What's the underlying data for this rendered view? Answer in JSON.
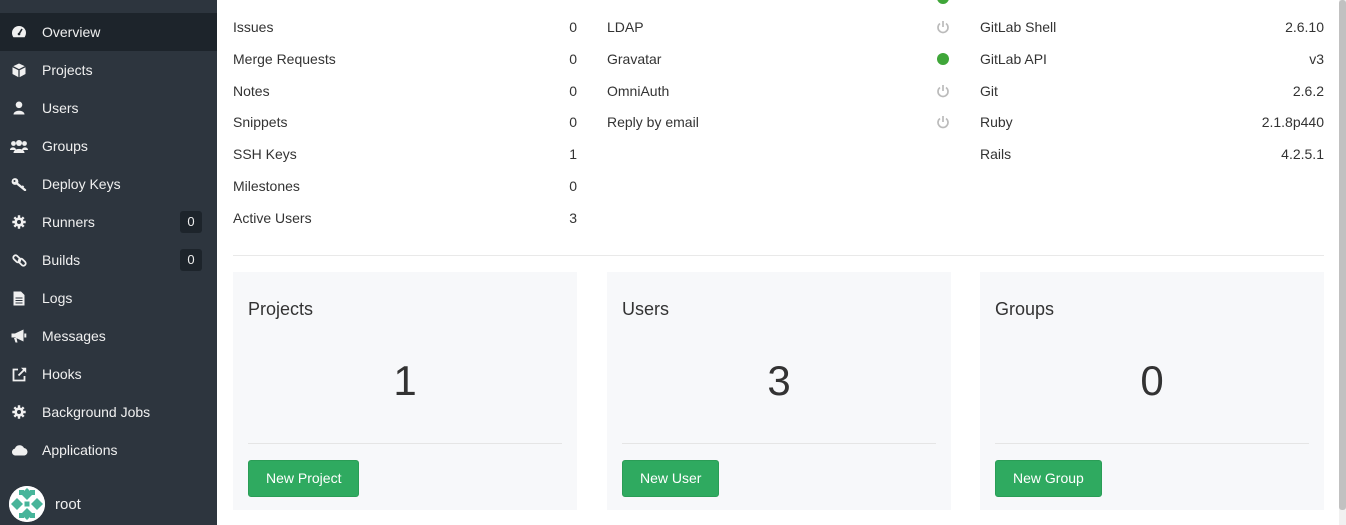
{
  "sidebar": {
    "items": [
      {
        "label": "Overview",
        "icon": "dashboard-icon",
        "active": true
      },
      {
        "label": "Projects",
        "icon": "cube-icon"
      },
      {
        "label": "Users",
        "icon": "user-icon"
      },
      {
        "label": "Groups",
        "icon": "users-icon"
      },
      {
        "label": "Deploy Keys",
        "icon": "key-icon"
      },
      {
        "label": "Runners",
        "icon": "cog-icon",
        "count": "0"
      },
      {
        "label": "Builds",
        "icon": "link-icon",
        "count": "0"
      },
      {
        "label": "Logs",
        "icon": "file-text-icon"
      },
      {
        "label": "Messages",
        "icon": "bullhorn-icon"
      },
      {
        "label": "Hooks",
        "icon": "external-link-icon"
      },
      {
        "label": "Background Jobs",
        "icon": "cog-icon"
      },
      {
        "label": "Applications",
        "icon": "cloud-icon"
      }
    ],
    "user": {
      "name": "root"
    }
  },
  "stats": [
    {
      "label": "Issues",
      "value": "0"
    },
    {
      "label": "Merge Requests",
      "value": "0"
    },
    {
      "label": "Notes",
      "value": "0"
    },
    {
      "label": "Snippets",
      "value": "0"
    },
    {
      "label": "SSH Keys",
      "value": "1"
    },
    {
      "label": "Milestones",
      "value": "0"
    },
    {
      "label": "Active Users",
      "value": "3"
    }
  ],
  "features": [
    {
      "label": "LDAP",
      "status": "off"
    },
    {
      "label": "Gravatar",
      "status": "on"
    },
    {
      "label": "OmniAuth",
      "status": "off"
    },
    {
      "label": "Reply by email",
      "status": "off"
    }
  ],
  "components": [
    {
      "label": "GitLab Shell",
      "value": "2.6.10"
    },
    {
      "label": "GitLab API",
      "value": "v3"
    },
    {
      "label": "Git",
      "value": "2.6.2"
    },
    {
      "label": "Ruby",
      "value": "2.1.8p440"
    },
    {
      "label": "Rails",
      "value": "4.2.5.1"
    }
  ],
  "panels": {
    "projects": {
      "title": "Projects",
      "count": "1",
      "button": "New Project"
    },
    "users": {
      "title": "Users",
      "count": "3",
      "button": "New User"
    },
    "groups": {
      "title": "Groups",
      "count": "0",
      "button": "New Group"
    }
  },
  "colors": {
    "sidebar": "#2d353e",
    "active": "#1d242b",
    "success": "#2faa60",
    "status_on": "#3fa639"
  }
}
